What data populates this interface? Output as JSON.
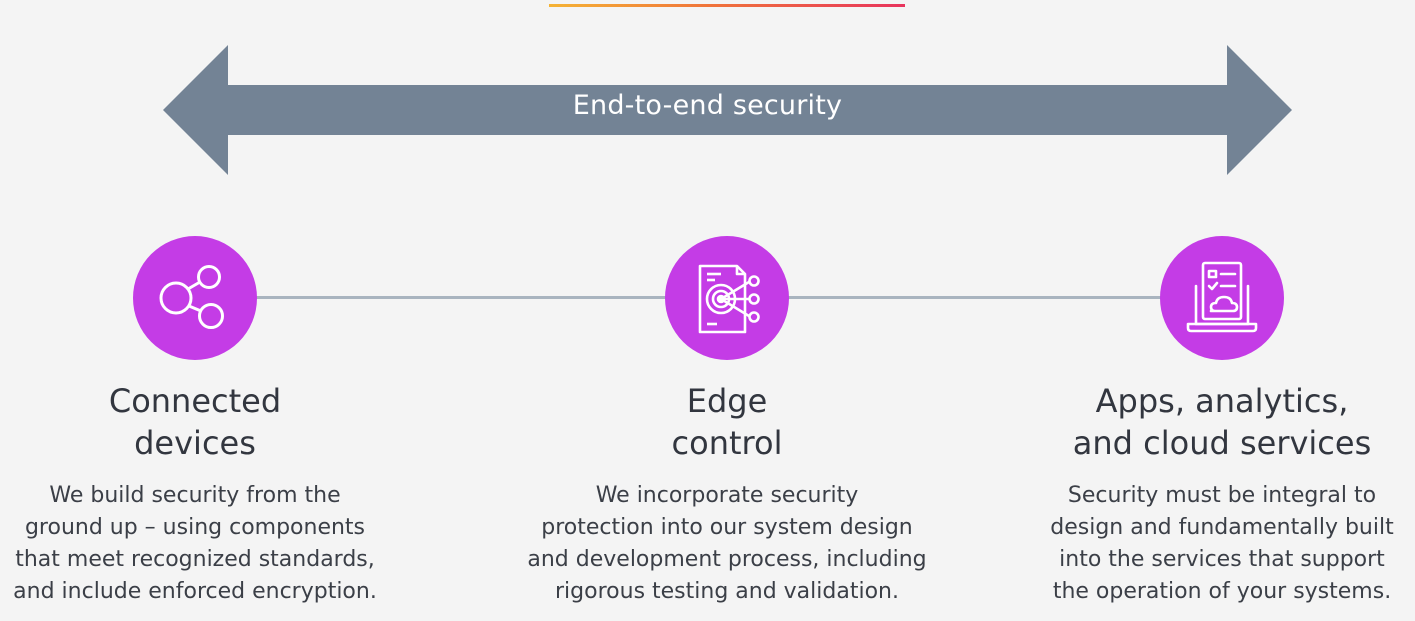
{
  "colors": {
    "background": "#f4f4f4",
    "arrow": "#738395",
    "accent": "#c43ce6",
    "connector": "#a9b4bf",
    "heading": "#32363f",
    "body_text": "#3b3f47"
  },
  "banner": {
    "label": "End-to-end security"
  },
  "columns": [
    {
      "icon": "share-network-icon",
      "title": [
        "Connected",
        "devices"
      ],
      "description": [
        "We build security from the",
        "ground up – using components",
        "that meet recognized standards,",
        "and include enforced encryption."
      ]
    },
    {
      "icon": "edge-target-document-icon",
      "title": [
        "Edge",
        "control"
      ],
      "description": [
        "We incorporate security",
        "protection into our system design",
        "and development process, including",
        "rigorous testing and validation."
      ]
    },
    {
      "icon": "laptop-cloud-checklist-icon",
      "title": [
        "Apps, analytics,",
        "and cloud services"
      ],
      "description": [
        "Security must be integral to",
        "design and fundamentally built",
        "into the services that support",
        "the operation of your systems."
      ]
    }
  ]
}
